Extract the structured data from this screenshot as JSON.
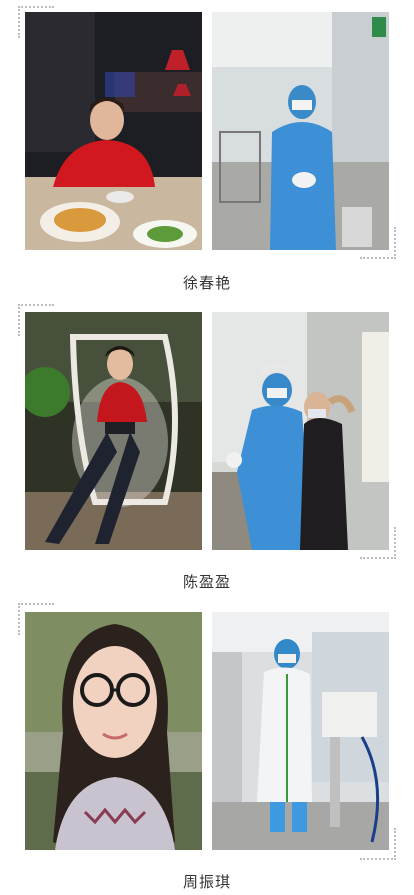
{
  "captions": [
    "徐春艳",
    "陈盈盈",
    "周振琪"
  ],
  "photos": [
    {
      "name": "restaurant-portrait"
    },
    {
      "name": "protective-suit-portrait"
    },
    {
      "name": "swing-chair-portrait"
    },
    {
      "name": "thumbs-up-portrait"
    },
    {
      "name": "selfie-portrait"
    },
    {
      "name": "hospital-corridor-portrait"
    }
  ]
}
